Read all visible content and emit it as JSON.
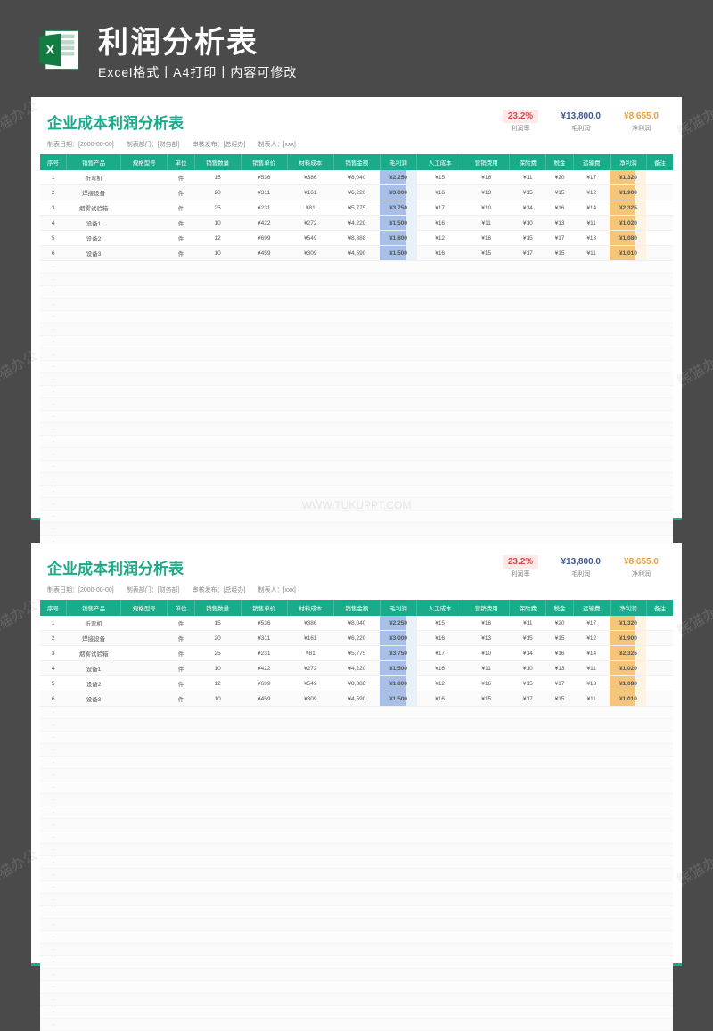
{
  "watermark": "熊猫办公",
  "wm_url": "WWW.TUKUPPT.COM",
  "header": {
    "title": "利润分析表",
    "subtitle": "Excel格式丨A4打印丨内容可修改"
  },
  "sheet": {
    "title": "企业成本利润分析表",
    "subinfo": "制表日期：[2000-00-00]　　制表部门：[财务部]　　审核发布：[总经办]　　制表人：[xxx]",
    "metrics": {
      "rate_val": "23.2%",
      "rate_lbl": "利润率",
      "gross_val": "¥13,800.0",
      "gross_lbl": "毛利润",
      "net_val": "¥8,655.0",
      "net_lbl": "净利润"
    },
    "columns": [
      "序号",
      "销售产品",
      "规格型号",
      "单位",
      "销售数量",
      "销售单价",
      "材料成本",
      "销售金额",
      "毛利润",
      "人工成本",
      "营销费用",
      "保险费",
      "税金",
      "运输费",
      "净利润",
      "备注"
    ],
    "rows": [
      {
        "c": [
          "1",
          "折弯机",
          "",
          "件",
          "15",
          "¥536",
          "¥386",
          "¥8,040",
          "¥2,250",
          "¥15",
          "¥16",
          "¥11",
          "¥20",
          "¥17",
          "¥1,320",
          ""
        ]
      },
      {
        "c": [
          "2",
          "焊接设备",
          "",
          "件",
          "20",
          "¥311",
          "¥161",
          "¥6,220",
          "¥3,000",
          "¥16",
          "¥13",
          "¥15",
          "¥15",
          "¥12",
          "¥1,900",
          ""
        ]
      },
      {
        "c": [
          "3",
          "烟雾试验箱",
          "",
          "件",
          "25",
          "¥231",
          "¥81",
          "¥5,775",
          "¥3,750",
          "¥17",
          "¥10",
          "¥14",
          "¥16",
          "¥14",
          "¥2,325",
          ""
        ]
      },
      {
        "c": [
          "4",
          "设备1",
          "",
          "件",
          "10",
          "¥422",
          "¥272",
          "¥4,220",
          "¥1,500",
          "¥16",
          "¥11",
          "¥10",
          "¥13",
          "¥11",
          "¥1,020",
          ""
        ]
      },
      {
        "c": [
          "5",
          "设备2",
          "",
          "件",
          "12",
          "¥699",
          "¥549",
          "¥8,388",
          "¥1,800",
          "¥12",
          "¥16",
          "¥15",
          "¥17",
          "¥13",
          "¥1,080",
          ""
        ]
      },
      {
        "c": [
          "6",
          "设备3",
          "",
          "件",
          "10",
          "¥459",
          "¥309",
          "¥4,590",
          "¥1,500",
          "¥16",
          "¥15",
          "¥17",
          "¥15",
          "¥11",
          "¥1,010",
          ""
        ]
      }
    ]
  },
  "chart_data": {
    "type": "table",
    "title": "企业成本利润分析表",
    "columns": [
      "序号",
      "销售产品",
      "规格型号",
      "单位",
      "销售数量",
      "销售单价",
      "材料成本",
      "销售金额",
      "毛利润",
      "人工成本",
      "营销费用",
      "保险费",
      "税金",
      "运输费",
      "净利润",
      "备注"
    ],
    "rows": [
      [
        1,
        "折弯机",
        "",
        "件",
        15,
        536,
        386,
        8040,
        2250,
        15,
        16,
        11,
        20,
        17,
        1320,
        ""
      ],
      [
        2,
        "焊接设备",
        "",
        "件",
        20,
        311,
        161,
        6220,
        3000,
        16,
        13,
        15,
        15,
        12,
        1900,
        ""
      ],
      [
        3,
        "烟雾试验箱",
        "",
        "件",
        25,
        231,
        81,
        5775,
        3750,
        17,
        10,
        14,
        16,
        14,
        2325,
        ""
      ],
      [
        4,
        "设备1",
        "",
        "件",
        10,
        422,
        272,
        4220,
        1500,
        16,
        11,
        10,
        13,
        11,
        1020,
        ""
      ],
      [
        5,
        "设备2",
        "",
        "件",
        12,
        699,
        549,
        8388,
        1800,
        12,
        16,
        15,
        17,
        13,
        1080,
        ""
      ],
      [
        6,
        "设备3",
        "",
        "件",
        10,
        459,
        309,
        4590,
        1500,
        16,
        15,
        17,
        15,
        11,
        1010,
        ""
      ]
    ],
    "summary": {
      "profit_rate": 23.2,
      "gross_profit": 13800.0,
      "net_profit": 8655.0
    }
  }
}
